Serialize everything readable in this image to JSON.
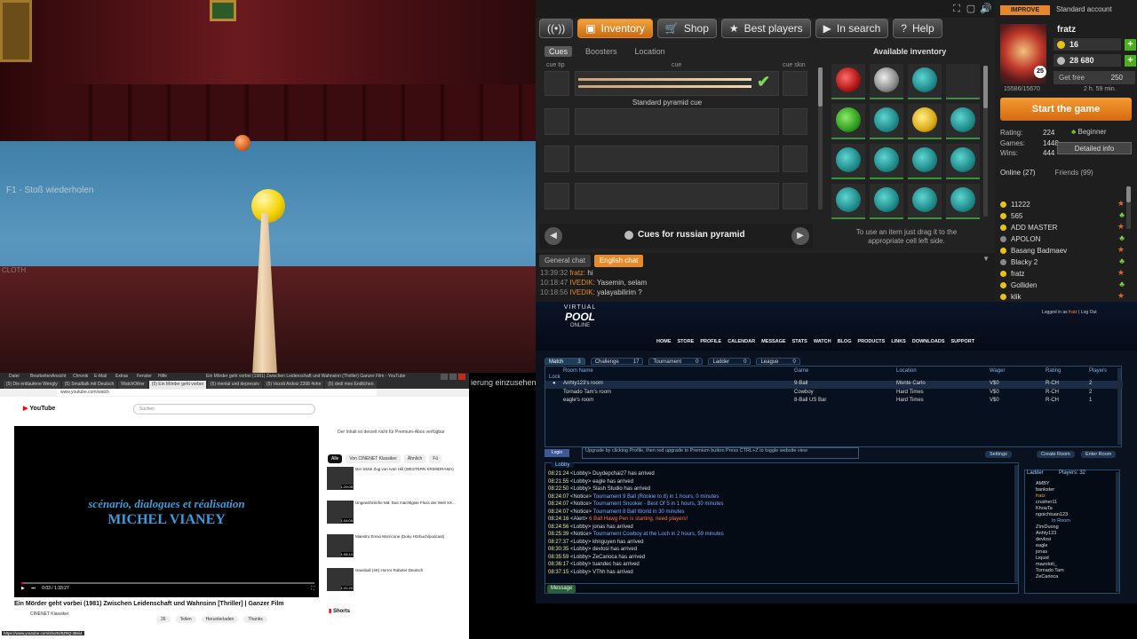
{
  "game": {
    "hint": "F1 - Stoß wiederholen",
    "cloth_label": "CLOTH"
  },
  "inventory": {
    "nav": [
      {
        "label": "Inventory",
        "icon": "box-icon"
      },
      {
        "label": "Shop",
        "icon": "cart-icon"
      },
      {
        "label": "Best players",
        "icon": "star-icon"
      },
      {
        "label": "In search",
        "icon": "play-icon"
      },
      {
        "label": "Help",
        "icon": "question-icon"
      }
    ],
    "subtabs": [
      "Cues",
      "Boosters",
      "Location"
    ],
    "headers": {
      "cue_tip": "cue tip",
      "cue": "cue",
      "cue_skin": "cue skin"
    },
    "equipped_cue": "Standard pyramid cue",
    "available_title": "Available inventory",
    "page_label": "Cues for russian pyramid",
    "drag_hint": "To use an item just drag it to the appropriate cell left side."
  },
  "sidebar": {
    "improve": "IMPROVE",
    "account": "Standard account",
    "username": "fratz",
    "level": "25",
    "gold": "16",
    "silver": "28 680",
    "get_free": "Get free",
    "get_free_amount": "250",
    "experience": "15586/15670",
    "timer": "2 h. 59 min.",
    "start": "Start the game",
    "rating_label": "Rating:",
    "rating": "224",
    "games_label": "Games:",
    "games": "1448",
    "wins_label": "Wins:",
    "wins": "444",
    "rank": "Beginner",
    "detailed": "Detailed info",
    "online_tab": "Online (27)",
    "friends_tab": "Friends (99)",
    "friends": [
      {
        "name": "11222"
      },
      {
        "name": "565"
      },
      {
        "name": "ADD MASTER"
      },
      {
        "name": "APOLON"
      },
      {
        "name": "Basang Badmaev"
      },
      {
        "name": "Blacky 2"
      },
      {
        "name": "fratz"
      },
      {
        "name": "Gollіden"
      },
      {
        "name": "klik"
      }
    ],
    "multiplier": "2x"
  },
  "chat": {
    "tabs": [
      "General chat",
      "English chat"
    ],
    "lines": [
      {
        "time": "13:39:32",
        "name": "fratz:",
        "text": "hi"
      },
      {
        "time": "10:18:47",
        "name": "IVEDIK:",
        "text": "Yasemin, selam"
      },
      {
        "time": "10:18:56",
        "name": "IVEDIK:",
        "text": "yalayabilirim ?"
      }
    ]
  },
  "youtube": {
    "window_title": "Ein Mörder geht vorbei (1981) Zwischen Leidenschaft und Wahnsinn (Thriller) Ganzer Film - YouTube",
    "menu": [
      "Datei",
      "Bearbeiten",
      "Ansicht",
      "Chronik",
      "E-Mail",
      "Extras",
      "Fenster",
      "Hilfe"
    ],
    "tabs": [
      "(5) Die entlaufene Wengly",
      "(5) Smalltalk mit Deutsch",
      "WatchOther",
      "(5) Ein Mörder geht vorbei",
      "(5) mental und depressiv",
      "(5) Vezolt Ardoiz 2398 4ohn",
      "(5) dedi mes Endlichen"
    ],
    "url": "www.youtube.com/watch",
    "logo": "YouTube",
    "search_placeholder": "Suchen",
    "subtitle_line1": "scénario, dialogues et réalisation",
    "subtitle_line2": "MICHEL VIANEY",
    "time": "0:03 / 1:33:27",
    "video_title": "Ein Mörder geht vorbei (1981) Zwischen Leidenschaft und Wahnsinn [Thriller] | Ganzer Film",
    "channel": "CINENET Klassiker",
    "actions": [
      "26",
      "Teilen",
      "Herunterladen",
      "Thanks"
    ],
    "side_note": "Der Inhalt ist derzeit nicht für Premium-Abos verfügbar",
    "chips": [
      "Alle",
      "Von CINENET Klassiker",
      "Ähnlich",
      "Fü"
    ],
    "recs": [
      {
        "title": "Der letzte Zug von Ivan Hill (WESTERN KRIMIDRAMA)",
        "dur": "1:29:05"
      },
      {
        "title": "Ungewöhnliche Mä: Das mächtigste Fluss der Welt XX...",
        "dur": "1:04:05"
      },
      {
        "title": "Maestro Ennio Morricone (Doku Hörbuch/podcast)",
        "dur": "1:08:10"
      },
      {
        "title": "Hausball (4K) Horror Roboter Deutsch",
        "dur": "1:31:20"
      }
    ],
    "shorts": "Shorts",
    "status_url": "https://www.youtube.com/shorts/9Z9Q-38ei4"
  },
  "vpo": {
    "logo": [
      "VIRTUAL",
      "POOL",
      "ONLINE"
    ],
    "logged_in": "Logged in as",
    "user": "fratz",
    "logout": "Log Out",
    "nav": [
      "HOME",
      "STORE",
      "PROFILE",
      "CALENDAR",
      "MESSAGE",
      "STATS",
      "WATCH",
      "BLOG",
      "PRODUCTS",
      "LINKS",
      "DOWNLOADS",
      "SUPPORT"
    ],
    "tabs": [
      {
        "label": "Match",
        "count": "3"
      },
      {
        "label": "Challenge",
        "count": "17"
      },
      {
        "label": "Tournament",
        "count": "0"
      },
      {
        "label": "Ladder",
        "count": "0"
      },
      {
        "label": "League",
        "count": "0"
      }
    ],
    "columns": [
      "Lock",
      "Room Name",
      "Game",
      "Location",
      "Wager",
      "Rating",
      "Players"
    ],
    "rooms": [
      {
        "lock": "●",
        "name": "Anhty123's room",
        "game": "9-Ball",
        "location": "Monte Carlo",
        "wager": "V$0",
        "rating": "R-CH",
        "players": "2"
      },
      {
        "lock": "",
        "name": "Tornado Tam's room",
        "game": "Cowboy",
        "location": "Hard Times",
        "wager": "V$0",
        "rating": "R-CH",
        "players": "2"
      },
      {
        "lock": "",
        "name": "eagle's room",
        "game": "8-Ball US Bar",
        "location": "Hard Times",
        "wager": "V$0",
        "rating": "R-CH",
        "players": "1"
      }
    ],
    "fb": "Login",
    "ticker": "Upgrade by clicking Profile, then red upgrade to Premium button Press CTRL+Z to toggle website view",
    "settings": "Settings",
    "create": "Create Room",
    "enter": "Enter Room",
    "lobby_title": "Lobby",
    "lobby": [
      {
        "time": "08:21:24",
        "src": "<Lobby>",
        "text": "Duydepchai27 has arrived"
      },
      {
        "time": "08:21:55",
        "src": "<Lobby>",
        "text": "eagle has arrived"
      },
      {
        "time": "08:22:50",
        "src": "<Lobby>",
        "text": "Slash Studio has arrived"
      },
      {
        "time": "08:24:07",
        "src": "<Notice>",
        "text": "Tournament 9 Ball (Rookie to 8) in 1 hours, 0 minutes"
      },
      {
        "time": "08:24:07",
        "src": "<Notice>",
        "text": "Tournament Snooker - Best Of 5 in 1 hours, 30 minutes"
      },
      {
        "time": "08:24:07",
        "src": "<Notice>",
        "text": "Tournament 8 Ball World in 30 minutes"
      },
      {
        "time": "08:24:16",
        "src": "<Alert>",
        "text": "6 Ball Hawg Pen is starting, need players!"
      },
      {
        "time": "08:24:56",
        "src": "<Lobby>",
        "text": "jonas has arrived"
      },
      {
        "time": "08:25:39",
        "src": "<Notice>",
        "text": "Tournament Cowboy at the Loch in 2 hours, 59 minutes"
      },
      {
        "time": "08:27:37",
        "src": "<Lobby>",
        "text": "khnguyen has arrived"
      },
      {
        "time": "08:30:35",
        "src": "<Lobby>",
        "text": "devlosi has arrived"
      },
      {
        "time": "08:35:59",
        "src": "<Lobby>",
        "text": "ZeCarioca has arrived"
      },
      {
        "time": "08:36:17",
        "src": "<Lobby>",
        "text": "tuandec has arrived"
      },
      {
        "time": "08:37:15",
        "src": "<Lobby>",
        "text": "VThh has arrived"
      }
    ],
    "ladder_title": "Ladder",
    "players_label": "Players: 32",
    "ladder": [
      "AMBY",
      "bankster",
      "fratz",
      "crusher11",
      "KhoaTa",
      "ngoichtuan123"
    ],
    "in_room_label": "In Room",
    "in_room": [
      "ZImDuong",
      "Anhty123",
      "devlosi",
      "eagle",
      "jonas",
      "Liquid",
      "mazototi_",
      "Tornado Tam",
      "ZeCarioca"
    ],
    "message_label": "Message",
    "overlay_text": "ierung einzusehen"
  }
}
